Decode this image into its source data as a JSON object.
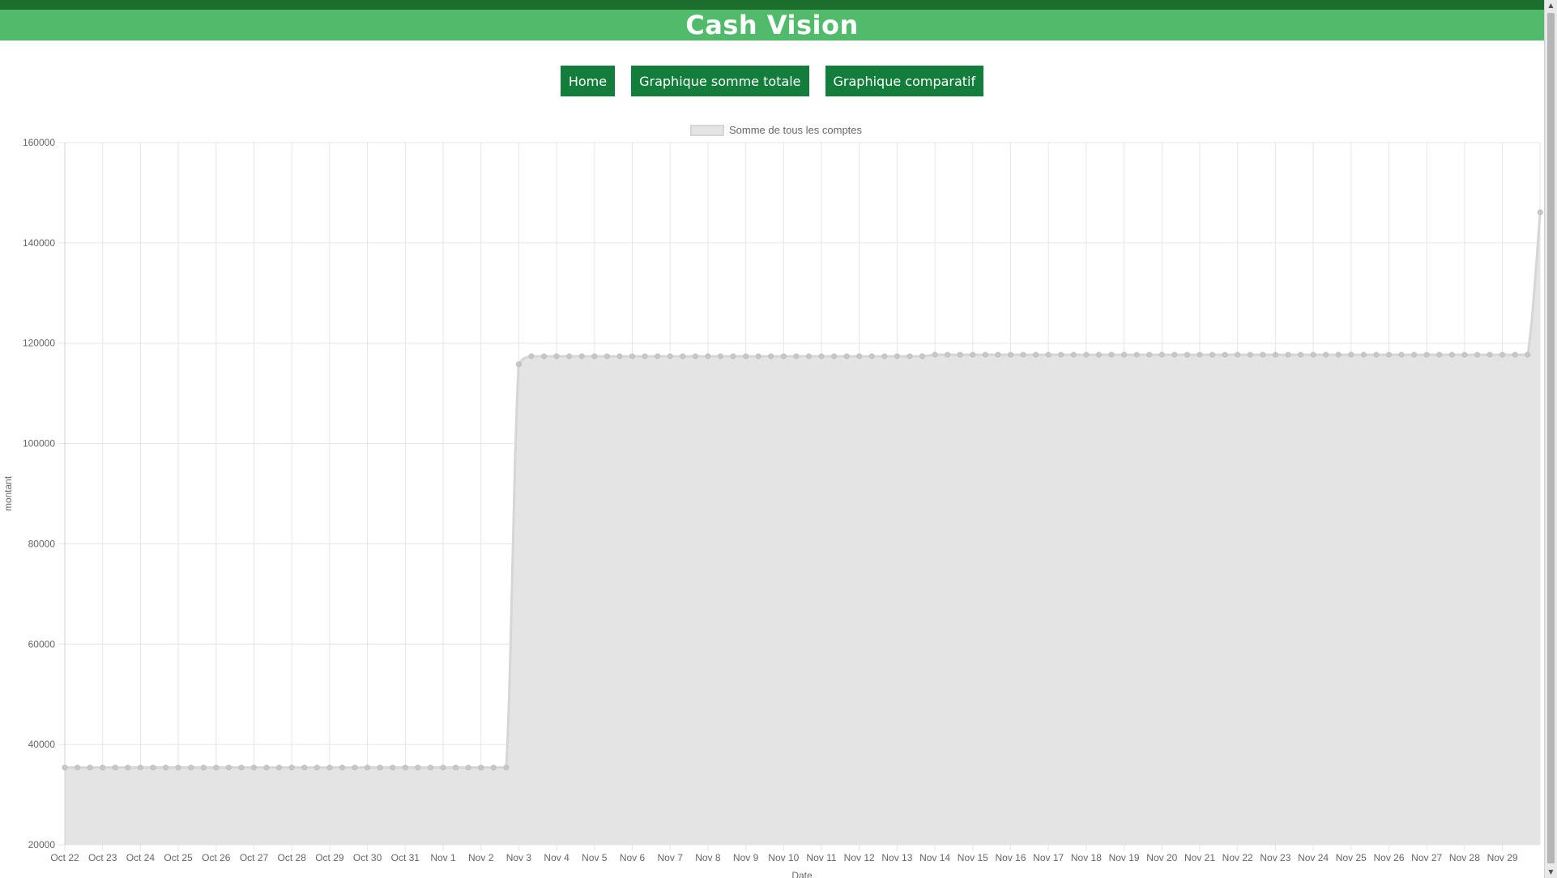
{
  "app": {
    "title": "Cash Vision"
  },
  "nav": {
    "home_label": "Home",
    "total_label": "Graphique somme totale",
    "compare_label": "Graphique comparatif"
  },
  "chart_data": {
    "type": "area",
    "title": "",
    "legend": {
      "entries": [
        "Somme de tous les comptes"
      ],
      "placement": "top-center"
    },
    "ylabel": "montant",
    "xlabel": "Date",
    "ylim": [
      20000,
      160000
    ],
    "yticks": [
      20000,
      40000,
      60000,
      80000,
      100000,
      120000,
      140000,
      160000
    ],
    "grid": true,
    "colors": {
      "fill": "#e4e4e4",
      "line": "#d6d6d6",
      "point": "#c8c8c8",
      "grid": "#e6e6e6"
    },
    "xticks": [
      "Oct 22",
      "Oct 23",
      "Oct 24",
      "Oct 25",
      "Oct 26",
      "Oct 27",
      "Oct 28",
      "Oct 29",
      "Oct 30",
      "Oct 31",
      "Nov 1",
      "Nov 2",
      "Nov 3",
      "Nov 4",
      "Nov 5",
      "Nov 6",
      "Nov 7",
      "Nov 8",
      "Nov 9",
      "Nov 10",
      "Nov 11",
      "Nov 12",
      "Nov 13",
      "Nov 14",
      "Nov 15",
      "Nov 16",
      "Nov 17",
      "Nov 18",
      "Nov 19",
      "Nov 20",
      "Nov 21",
      "Nov 22",
      "Nov 23",
      "Nov 24",
      "Nov 25",
      "Nov 26",
      "Nov 27",
      "Nov 28",
      "Nov 29"
    ],
    "xstart": "2023-10-22",
    "series": [
      {
        "name": "Somme de tous les comptes",
        "points": [
          {
            "x": "2023-10-22T00:00",
            "y": 35400
          },
          {
            "x": "2023-10-22T08:00",
            "y": 35400
          },
          {
            "x": "2023-10-22T16:00",
            "y": 35400
          },
          {
            "x": "2023-10-23T00:00",
            "y": 35400
          },
          {
            "x": "2023-10-23T08:00",
            "y": 35400
          },
          {
            "x": "2023-10-23T16:00",
            "y": 35400
          },
          {
            "x": "2023-10-24T00:00",
            "y": 35400
          },
          {
            "x": "2023-10-24T08:00",
            "y": 35400
          },
          {
            "x": "2023-10-24T16:00",
            "y": 35400
          },
          {
            "x": "2023-10-25T00:00",
            "y": 35400
          },
          {
            "x": "2023-10-25T08:00",
            "y": 35400
          },
          {
            "x": "2023-10-25T16:00",
            "y": 35400
          },
          {
            "x": "2023-10-26T00:00",
            "y": 35400
          },
          {
            "x": "2023-10-26T08:00",
            "y": 35400
          },
          {
            "x": "2023-10-26T16:00",
            "y": 35400
          },
          {
            "x": "2023-10-27T00:00",
            "y": 35400
          },
          {
            "x": "2023-10-27T08:00",
            "y": 35400
          },
          {
            "x": "2023-10-27T16:00",
            "y": 35400
          },
          {
            "x": "2023-10-28T00:00",
            "y": 35400
          },
          {
            "x": "2023-10-28T08:00",
            "y": 35400
          },
          {
            "x": "2023-10-28T16:00",
            "y": 35400
          },
          {
            "x": "2023-10-29T00:00",
            "y": 35400
          },
          {
            "x": "2023-10-29T08:00",
            "y": 35400
          },
          {
            "x": "2023-10-29T16:00",
            "y": 35400
          },
          {
            "x": "2023-10-30T00:00",
            "y": 35400
          },
          {
            "x": "2023-10-30T08:00",
            "y": 35400
          },
          {
            "x": "2023-10-30T16:00",
            "y": 35400
          },
          {
            "x": "2023-10-31T00:00",
            "y": 35400
          },
          {
            "x": "2023-10-31T08:00",
            "y": 35400
          },
          {
            "x": "2023-10-31T16:00",
            "y": 35400
          },
          {
            "x": "2023-11-01T00:00",
            "y": 35400
          },
          {
            "x": "2023-11-01T08:00",
            "y": 35400
          },
          {
            "x": "2023-11-01T16:00",
            "y": 35400
          },
          {
            "x": "2023-11-02T00:00",
            "y": 35400
          },
          {
            "x": "2023-11-02T08:00",
            "y": 35400
          },
          {
            "x": "2023-11-02T16:00",
            "y": 35400
          },
          {
            "x": "2023-11-03T00:00",
            "y": 115800
          },
          {
            "x": "2023-11-03T08:00",
            "y": 117400
          },
          {
            "x": "2023-11-03T16:00",
            "y": 117400
          },
          {
            "x": "2023-11-04T00:00",
            "y": 117400
          },
          {
            "x": "2023-11-04T08:00",
            "y": 117400
          },
          {
            "x": "2023-11-04T16:00",
            "y": 117400
          },
          {
            "x": "2023-11-05T00:00",
            "y": 117400
          },
          {
            "x": "2023-11-05T08:00",
            "y": 117400
          },
          {
            "x": "2023-11-05T16:00",
            "y": 117400
          },
          {
            "x": "2023-11-06T00:00",
            "y": 117400
          },
          {
            "x": "2023-11-06T08:00",
            "y": 117400
          },
          {
            "x": "2023-11-06T16:00",
            "y": 117400
          },
          {
            "x": "2023-11-07T00:00",
            "y": 117400
          },
          {
            "x": "2023-11-07T08:00",
            "y": 117400
          },
          {
            "x": "2023-11-07T16:00",
            "y": 117400
          },
          {
            "x": "2023-11-08T00:00",
            "y": 117400
          },
          {
            "x": "2023-11-08T08:00",
            "y": 117400
          },
          {
            "x": "2023-11-08T16:00",
            "y": 117400
          },
          {
            "x": "2023-11-09T00:00",
            "y": 117400
          },
          {
            "x": "2023-11-09T08:00",
            "y": 117400
          },
          {
            "x": "2023-11-09T16:00",
            "y": 117400
          },
          {
            "x": "2023-11-10T00:00",
            "y": 117400
          },
          {
            "x": "2023-11-10T08:00",
            "y": 117400
          },
          {
            "x": "2023-11-10T16:00",
            "y": 117400
          },
          {
            "x": "2023-11-11T00:00",
            "y": 117400
          },
          {
            "x": "2023-11-11T08:00",
            "y": 117400
          },
          {
            "x": "2023-11-11T16:00",
            "y": 117400
          },
          {
            "x": "2023-11-12T00:00",
            "y": 117400
          },
          {
            "x": "2023-11-12T08:00",
            "y": 117400
          },
          {
            "x": "2023-11-12T16:00",
            "y": 117400
          },
          {
            "x": "2023-11-13T00:00",
            "y": 117400
          },
          {
            "x": "2023-11-13T08:00",
            "y": 117400
          },
          {
            "x": "2023-11-13T16:00",
            "y": 117400
          },
          {
            "x": "2023-11-14T00:00",
            "y": 117700
          },
          {
            "x": "2023-11-14T08:00",
            "y": 117700
          },
          {
            "x": "2023-11-14T16:00",
            "y": 117700
          },
          {
            "x": "2023-11-15T00:00",
            "y": 117700
          },
          {
            "x": "2023-11-15T08:00",
            "y": 117700
          },
          {
            "x": "2023-11-15T16:00",
            "y": 117700
          },
          {
            "x": "2023-11-16T00:00",
            "y": 117700
          },
          {
            "x": "2023-11-16T08:00",
            "y": 117700
          },
          {
            "x": "2023-11-16T16:00",
            "y": 117700
          },
          {
            "x": "2023-11-17T00:00",
            "y": 117700
          },
          {
            "x": "2023-11-17T08:00",
            "y": 117700
          },
          {
            "x": "2023-11-17T16:00",
            "y": 117700
          },
          {
            "x": "2023-11-18T00:00",
            "y": 117700
          },
          {
            "x": "2023-11-18T08:00",
            "y": 117700
          },
          {
            "x": "2023-11-18T16:00",
            "y": 117700
          },
          {
            "x": "2023-11-19T00:00",
            "y": 117700
          },
          {
            "x": "2023-11-19T08:00",
            "y": 117700
          },
          {
            "x": "2023-11-19T16:00",
            "y": 117700
          },
          {
            "x": "2023-11-20T00:00",
            "y": 117700
          },
          {
            "x": "2023-11-20T08:00",
            "y": 117700
          },
          {
            "x": "2023-11-20T16:00",
            "y": 117700
          },
          {
            "x": "2023-11-21T00:00",
            "y": 117700
          },
          {
            "x": "2023-11-21T08:00",
            "y": 117700
          },
          {
            "x": "2023-11-21T16:00",
            "y": 117700
          },
          {
            "x": "2023-11-22T00:00",
            "y": 117700
          },
          {
            "x": "2023-11-22T08:00",
            "y": 117700
          },
          {
            "x": "2023-11-22T16:00",
            "y": 117700
          },
          {
            "x": "2023-11-23T00:00",
            "y": 117700
          },
          {
            "x": "2023-11-23T08:00",
            "y": 117700
          },
          {
            "x": "2023-11-23T16:00",
            "y": 117700
          },
          {
            "x": "2023-11-24T00:00",
            "y": 117700
          },
          {
            "x": "2023-11-24T08:00",
            "y": 117700
          },
          {
            "x": "2023-11-24T16:00",
            "y": 117700
          },
          {
            "x": "2023-11-25T00:00",
            "y": 117700
          },
          {
            "x": "2023-11-25T08:00",
            "y": 117700
          },
          {
            "x": "2023-11-25T16:00",
            "y": 117700
          },
          {
            "x": "2023-11-26T00:00",
            "y": 117700
          },
          {
            "x": "2023-11-26T08:00",
            "y": 117700
          },
          {
            "x": "2023-11-26T16:00",
            "y": 117700
          },
          {
            "x": "2023-11-27T00:00",
            "y": 117700
          },
          {
            "x": "2023-11-27T08:00",
            "y": 117700
          },
          {
            "x": "2023-11-27T16:00",
            "y": 117700
          },
          {
            "x": "2023-11-28T00:00",
            "y": 117700
          },
          {
            "x": "2023-11-28T08:00",
            "y": 117700
          },
          {
            "x": "2023-11-28T16:00",
            "y": 117700
          },
          {
            "x": "2023-11-29T00:00",
            "y": 117700
          },
          {
            "x": "2023-11-29T08:00",
            "y": 117700
          },
          {
            "x": "2023-11-29T16:00",
            "y": 117700
          },
          {
            "x": "2023-11-30T00:00",
            "y": 146100
          }
        ]
      }
    ]
  }
}
